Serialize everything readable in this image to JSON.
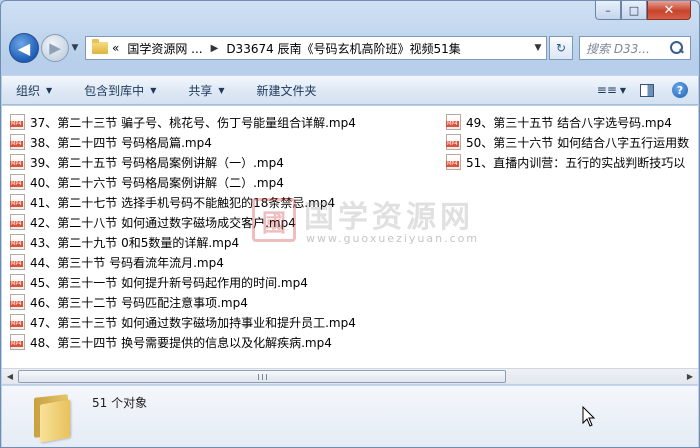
{
  "window": {
    "caption": {
      "minimize": "–",
      "maximize": "□",
      "close": "✕"
    }
  },
  "nav": {
    "back_icon": "back-arrow-icon",
    "forward_icon": "forward-arrow-icon",
    "address": {
      "overflow": "«",
      "crumbs": [
        "国学资源网 ...",
        "D33674 辰南《号码玄机高阶班》视频51集"
      ]
    },
    "search": {
      "placeholder": "搜索 D33..."
    }
  },
  "toolbar": {
    "organize": "组织",
    "include_in_library": "包含到库中",
    "share": "共享",
    "new_folder": "新建文件夹"
  },
  "files": {
    "col1": [
      "37、第二十三节 骗子号、桃花号、伤丁号能量组合详解.mp4",
      "38、第二十四节 号码格局篇.mp4",
      "39、第二十五节 号码格局案例讲解（一）.mp4",
      "40、第二十六节 号码格局案例讲解（二）.mp4",
      "41、第二十七节 选择手机号码不能触犯的18条禁忌.mp4",
      "42、第二十八节 如何通过数字磁场成交客户.mp4",
      "43、第二十九节 0和5数量的详解.mp4",
      "44、第三十节 号码看流年流月.mp4",
      "45、第三十一节 如何提升新号码起作用的时间.mp4",
      "46、第三十二节 号码匹配注意事项.mp4",
      "47、第三十三节 如何通过数字磁场加持事业和提升员工.mp4",
      "48、第三十四节 换号需要提供的信息以及化解疾病.mp4"
    ],
    "col2": [
      "49、第三十五节 结合八字选号码.mp4",
      "50、第三十六节 如何结合八字五行运用数",
      "51、直播内训营：五行的实战判断技巧以"
    ]
  },
  "watermark": {
    "seal": "國",
    "title": "国学资源网",
    "url": "www.guoxueziyuan.com"
  },
  "status": {
    "count": "51 个对象"
  }
}
